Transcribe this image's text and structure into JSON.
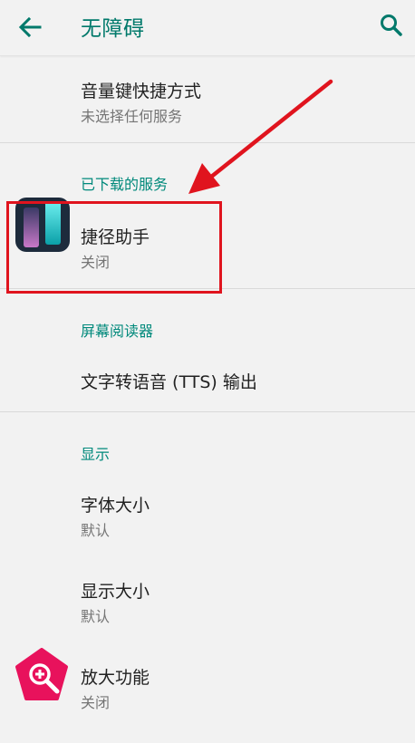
{
  "header": {
    "title": "无障碍",
    "back_icon": "arrow-left-icon",
    "search_icon": "search-icon"
  },
  "shortcut": {
    "title": "音量键快捷方式",
    "subtitle": "未选择任何服务"
  },
  "downloaded": {
    "header": "已下载的服务",
    "app": {
      "title": "捷径助手",
      "subtitle": "关闭",
      "icon": "shortcut-assistant-app-icon"
    }
  },
  "screen_reader": {
    "header": "屏幕阅读器",
    "tts": "文字转语音 (TTS) 输出"
  },
  "display": {
    "header": "显示",
    "font_size": {
      "title": "字体大小",
      "subtitle": "默认"
    },
    "display_size": {
      "title": "显示大小",
      "subtitle": "默认"
    },
    "magnification": {
      "title": "放大功能",
      "subtitle": "关闭",
      "icon": "magnifier-icon"
    }
  },
  "colors": {
    "accent": "#00796b",
    "section": "#00897b",
    "annotation": "#e0141e",
    "magnifier": "#e8125c"
  }
}
